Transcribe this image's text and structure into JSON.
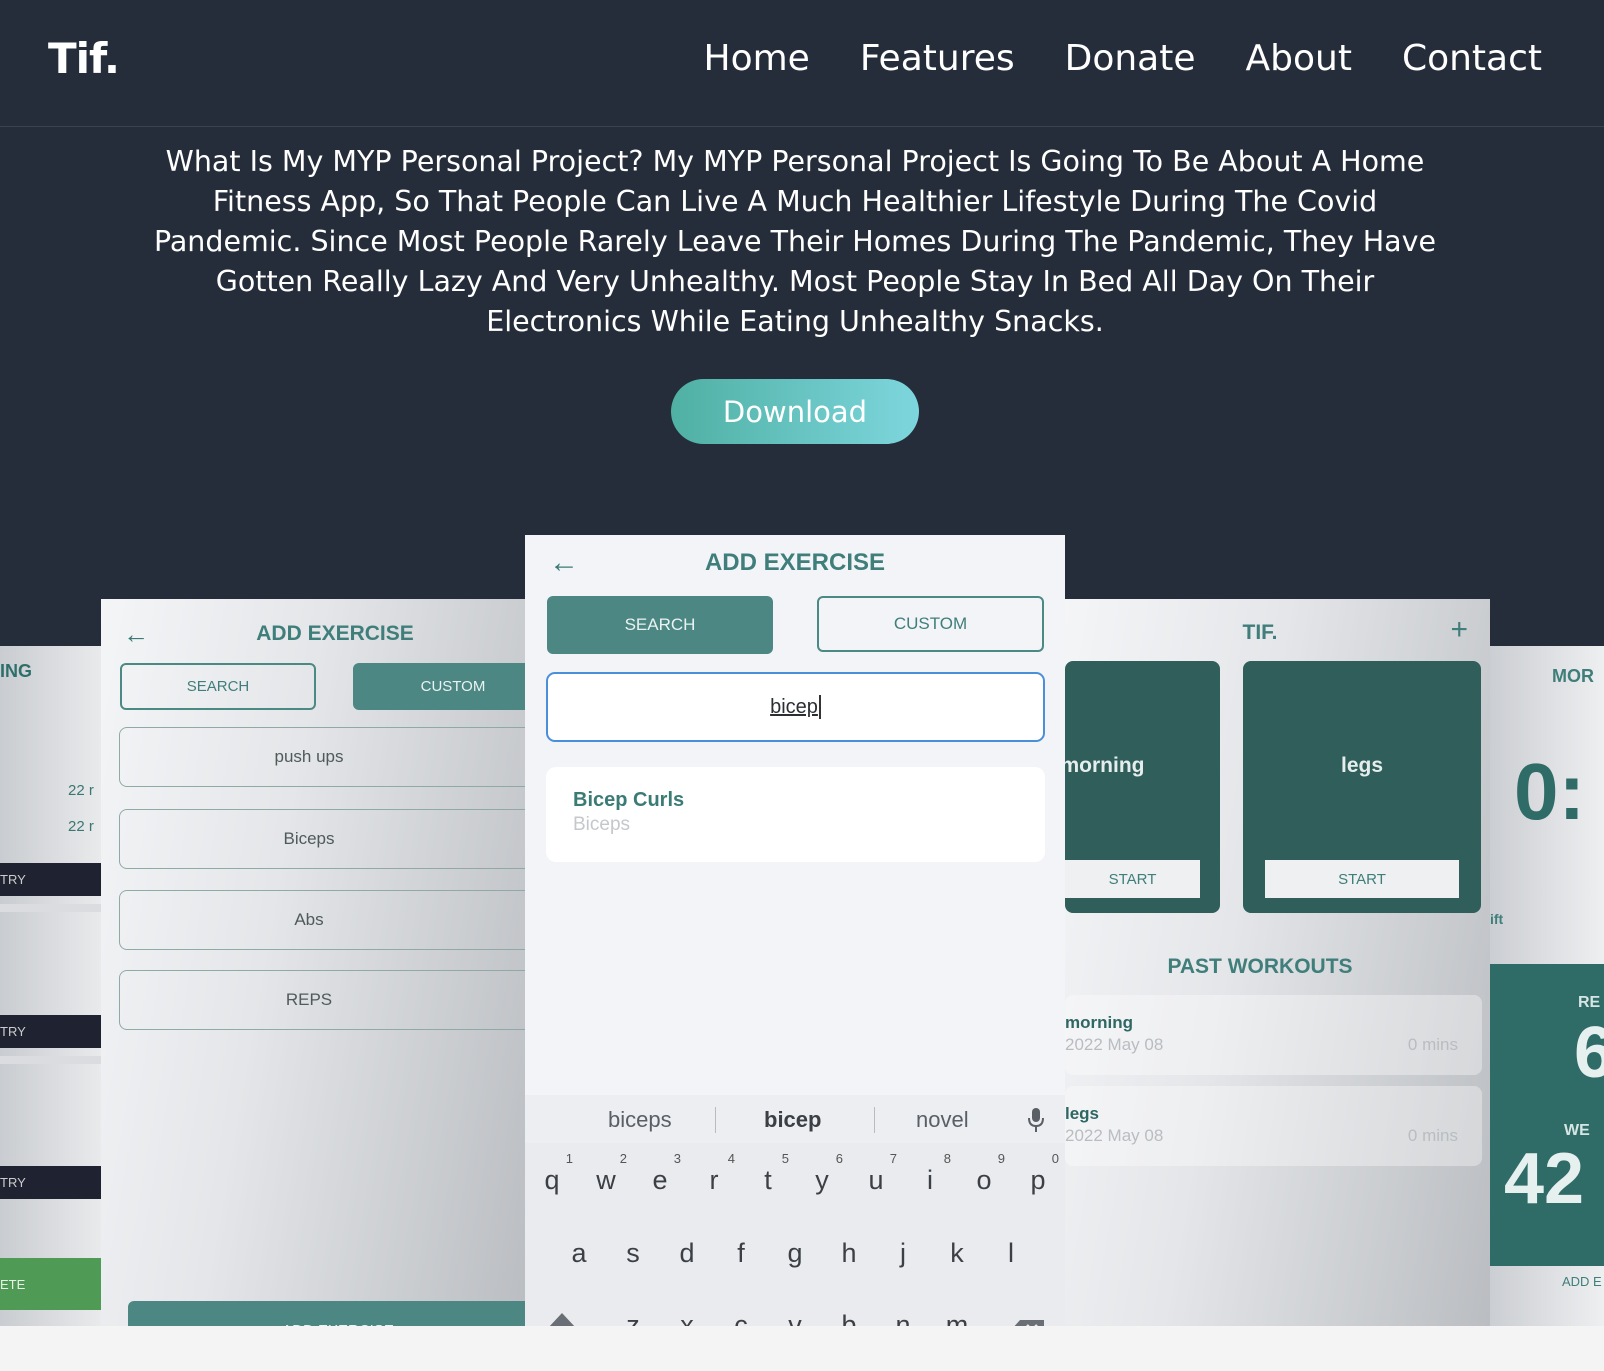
{
  "header": {
    "logo": "Tif.",
    "nav": [
      "Home",
      "Features",
      "Donate",
      "About",
      "Contact"
    ]
  },
  "intro": {
    "text": "What Is My MYP Personal Project? My MYP Personal Project Is Going To Be About A Home Fitness App, So That People Can Live A Much Healthier Lifestyle During The Covid Pandemic. Since Most People Rarely Leave Their Homes During The Pandemic, They Have Gotten Really Lazy And Very Unhealthy. Most People Stay In Bed All Day On Their Electronics While Eating Unhealthy Snacks.",
    "download_label": "Download"
  },
  "far_left": {
    "title": "ING",
    "dates": [
      "22 r",
      "22 r"
    ],
    "entry_label": "TRY",
    "complete_label": "ETE"
  },
  "left_phone": {
    "back_glyph": "←",
    "title": "ADD EXERCISE",
    "tab_search": "SEARCH",
    "tab_custom": "CUSTOM",
    "fields": [
      "push ups",
      "Biceps",
      "Abs",
      "REPS"
    ],
    "add_button": "ADD EXERCISE"
  },
  "center_phone": {
    "back_glyph": "←",
    "title": "ADD EXERCISE",
    "tab_search": "SEARCH",
    "tab_custom": "CUSTOM",
    "search_value": "bicep",
    "result": {
      "name": "Bicep Curls",
      "category": "Biceps"
    },
    "keyboard": {
      "suggestions": [
        "biceps",
        "bicep",
        "novel"
      ],
      "row1": [
        "q",
        "w",
        "e",
        "r",
        "t",
        "y",
        "u",
        "i",
        "o",
        "p"
      ],
      "row1_nums": [
        "1",
        "2",
        "3",
        "4",
        "5",
        "6",
        "7",
        "8",
        "9",
        "0"
      ],
      "row2": [
        "a",
        "s",
        "d",
        "f",
        "g",
        "h",
        "j",
        "k",
        "l"
      ],
      "row3": [
        "z",
        "x",
        "c",
        "v",
        "b",
        "n",
        "m"
      ]
    }
  },
  "right_phone": {
    "title": "TIF.",
    "plus_glyph": "+",
    "cards": [
      {
        "label": "morning",
        "start": "START"
      },
      {
        "label": "legs",
        "start": "START"
      }
    ],
    "past_title": "PAST WORKOUTS",
    "workouts": [
      {
        "name": "morning",
        "date": "2022 May 08",
        "duration": "0 mins"
      },
      {
        "name": "legs",
        "date": "2022 May 08",
        "duration": "0 mins"
      }
    ]
  },
  "far_right": {
    "title": "MOR",
    "timer": "0:",
    "lift_label": "ift",
    "reps_label": "RE",
    "reps_value": "6",
    "weight_label": "WE",
    "weight_value": "42",
    "add_label": "ADD E"
  }
}
